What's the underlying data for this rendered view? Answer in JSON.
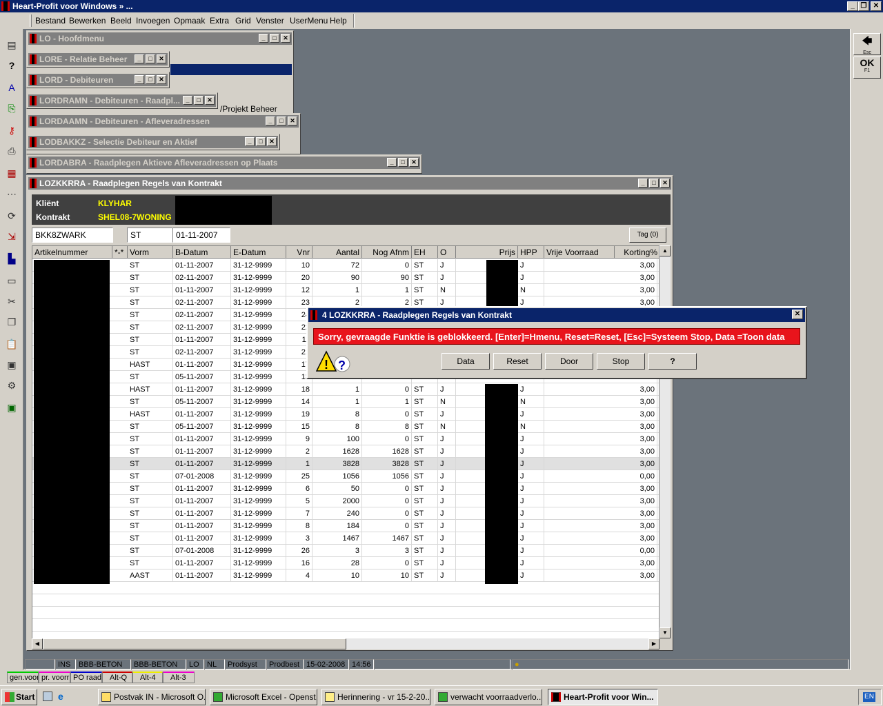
{
  "app": {
    "title": "Heart-Profit voor Windows  »  ..."
  },
  "menu": [
    "Bestand",
    "Bewerken",
    "Beeld",
    "Invoegen",
    "Opmaak",
    "Extra",
    "Grid",
    "Venster",
    "UserMenu",
    "Help"
  ],
  "windows": {
    "w1": "LO - Hoofdmenu",
    "w2": "LORE - Relatie Beheer",
    "w3": "LORD - Debiteuren",
    "w4": "LORDRAMN - Debiteuren - Raadpl...",
    "w5": "LORDAAMN - Debiteuren - Afleveradressen",
    "w6": "LODBAKKZ - Selectie Debiteur en Aktief",
    "w7": "LORDABRA - Raadplegen Aktieve Afleveradressen op Plaats",
    "main": "LOZKKRRA - Raadplegen Regels van Kontrakt",
    "hidden_text": "/Projekt Beheer"
  },
  "header": {
    "klient_label": "Kliënt",
    "klient_value": "KLYHAR",
    "kontrakt_label": "Kontrakt",
    "kontrakt_value": "SHEL08-7WONING"
  },
  "filter": {
    "f1": "BKK8ZWARK",
    "f2": "ST",
    "f3": "01-11-2007",
    "tag": "Tag (0)"
  },
  "columns": [
    "Artikelnummer",
    "*-*",
    "Vorm",
    "B-Datum",
    "E-Datum",
    "Vnr",
    "Aantal",
    "Nog Afnm",
    "EH",
    "O",
    "Prijs",
    "HPP",
    "Vrije Voorraad",
    "Korting%"
  ],
  "rows": [
    [
      "ST",
      "01-11-2007",
      "31-12-9999",
      "10",
      "72",
      "0",
      "ST",
      "J",
      "J",
      "3,00"
    ],
    [
      "ST",
      "02-11-2007",
      "31-12-9999",
      "20",
      "90",
      "90",
      "ST",
      "J",
      "J",
      "3,00"
    ],
    [
      "ST",
      "01-11-2007",
      "31-12-9999",
      "12",
      "1",
      "1",
      "ST",
      "N",
      "N",
      "3,00"
    ],
    [
      "ST",
      "02-11-2007",
      "31-12-9999",
      "23",
      "2",
      "2",
      "ST",
      "J",
      "J",
      "3,00"
    ],
    [
      "ST",
      "02-11-2007",
      "31-12-9999",
      "24",
      "",
      "",
      "",
      "",
      "",
      ""
    ],
    [
      "ST",
      "02-11-2007",
      "31-12-9999",
      "22",
      "",
      "",
      "",
      "",
      "",
      ""
    ],
    [
      "ST",
      "01-11-2007",
      "31-12-9999",
      "11",
      "",
      "",
      "",
      "",
      "",
      ""
    ],
    [
      "ST",
      "02-11-2007",
      "31-12-9999",
      "21",
      "",
      "",
      "",
      "",
      "",
      ""
    ],
    [
      "HAST",
      "01-11-2007",
      "31-12-9999",
      "17",
      "",
      "",
      "",
      "",
      "",
      ""
    ],
    [
      "ST",
      "05-11-2007",
      "31-12-9999",
      "13",
      "",
      "",
      "",
      "",
      "",
      ""
    ],
    [
      "HAST",
      "01-11-2007",
      "31-12-9999",
      "18",
      "1",
      "0",
      "ST",
      "J",
      "J",
      "3,00"
    ],
    [
      "ST",
      "05-11-2007",
      "31-12-9999",
      "14",
      "1",
      "1",
      "ST",
      "N",
      "N",
      "3,00"
    ],
    [
      "HAST",
      "01-11-2007",
      "31-12-9999",
      "19",
      "8",
      "0",
      "ST",
      "J",
      "J",
      "3,00"
    ],
    [
      "ST",
      "05-11-2007",
      "31-12-9999",
      "15",
      "8",
      "8",
      "ST",
      "N",
      "N",
      "3,00"
    ],
    [
      "ST",
      "01-11-2007",
      "31-12-9999",
      "9",
      "100",
      "0",
      "ST",
      "J",
      "J",
      "3,00"
    ],
    [
      "ST",
      "01-11-2007",
      "31-12-9999",
      "2",
      "1628",
      "1628",
      "ST",
      "J",
      "J",
      "3,00"
    ],
    [
      "ST",
      "01-11-2007",
      "31-12-9999",
      "1",
      "3828",
      "3828",
      "ST",
      "J",
      "J",
      "3,00"
    ],
    [
      "ST",
      "07-01-2008",
      "31-12-9999",
      "25",
      "1056",
      "1056",
      "ST",
      "J",
      "J",
      "0,00"
    ],
    [
      "ST",
      "01-11-2007",
      "31-12-9999",
      "6",
      "50",
      "0",
      "ST",
      "J",
      "J",
      "3,00"
    ],
    [
      "ST",
      "01-11-2007",
      "31-12-9999",
      "5",
      "2000",
      "0",
      "ST",
      "J",
      "J",
      "3,00"
    ],
    [
      "ST",
      "01-11-2007",
      "31-12-9999",
      "7",
      "240",
      "0",
      "ST",
      "J",
      "J",
      "3,00"
    ],
    [
      "ST",
      "01-11-2007",
      "31-12-9999",
      "8",
      "184",
      "0",
      "ST",
      "J",
      "J",
      "3,00"
    ],
    [
      "ST",
      "01-11-2007",
      "31-12-9999",
      "3",
      "1467",
      "1467",
      "ST",
      "J",
      "J",
      "3,00"
    ],
    [
      "ST",
      "07-01-2008",
      "31-12-9999",
      "26",
      "3",
      "3",
      "ST",
      "J",
      "J",
      "0,00"
    ],
    [
      "ST",
      "01-11-2007",
      "31-12-9999",
      "16",
      "28",
      "0",
      "ST",
      "J",
      "J",
      "3,00"
    ],
    [
      "AAST",
      "01-11-2007",
      "31-12-9999",
      "4",
      "10",
      "10",
      "ST",
      "J",
      "J",
      "3,00"
    ]
  ],
  "dialog": {
    "title": "4 LOZKKRRA - Raadplegen Regels van Kontrakt",
    "message": "Sorry, gevraagde Funktie is geblokkeerd.  [Enter]=Hmenu, Reset=Reset, [Esc]=Systeem Stop, Data =Toon data",
    "buttons": [
      "Data",
      "Reset",
      "Door",
      "Stop",
      "?"
    ]
  },
  "status": [
    "INS",
    "BBB-BETON",
    "BBB-BETON",
    "LO",
    "NL",
    "Prodsyst",
    "Prodbest",
    "15-02-2008",
    "14:56"
  ],
  "bottom_tabs": [
    "gen.voorr",
    "pr. voorr",
    "PO raadp",
    "Alt-Q",
    "Alt-4",
    "Alt-3"
  ],
  "taskbar": {
    "start": "Start",
    "tasks": [
      "Postvak IN - Microsoft O...",
      "Microsoft Excel - Openst...",
      "Herinnering - vr 15-2-20...",
      "verwacht voorraadverlo...",
      "Heart-Profit voor Win..."
    ],
    "lang": "EN"
  },
  "right_toolbar": {
    "esc": "Esc",
    "ok": "OK",
    "f1": "F1"
  }
}
